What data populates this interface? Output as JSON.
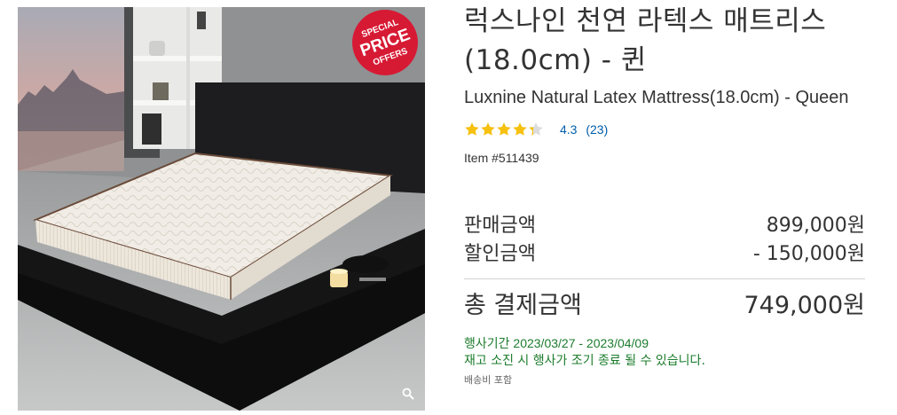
{
  "product": {
    "title_ko": "럭스나인 천연 라텍스 매트리스(18.0cm) - 퀸",
    "title_en": "Luxnine Natural Latex Mattress(18.0cm) - Queen",
    "image_alt": "Luxnine Natural Latex Mattress",
    "badge": {
      "line1": "SPECIAL",
      "line2": "PRICE",
      "line3": "OFFERS",
      "color": "#d71a34"
    }
  },
  "rating": {
    "stars_value": 4.3,
    "max_stars": 5,
    "score": "4.3",
    "count": "(23)",
    "star_color": "#f6c00e",
    "link_color": "#005dab"
  },
  "item_number": "Item #511439",
  "pricing": {
    "sale_label": "판매금액",
    "sale_value": "899,000원",
    "discount_label": "할인금액",
    "discount_value": "- 150,000원",
    "total_label": "총 결제금액",
    "total_value": "749,000원"
  },
  "promotion": {
    "period": "행사기간 2023/03/27 - 2023/04/09",
    "notice": "재고 소진 시 행사가 조기 종료 될 수 있습니다.",
    "color": "#1c7c2c"
  },
  "shipping_note": "배송비 포함",
  "icons": {
    "zoom": "magnifier-icon",
    "star": "star-icon"
  }
}
